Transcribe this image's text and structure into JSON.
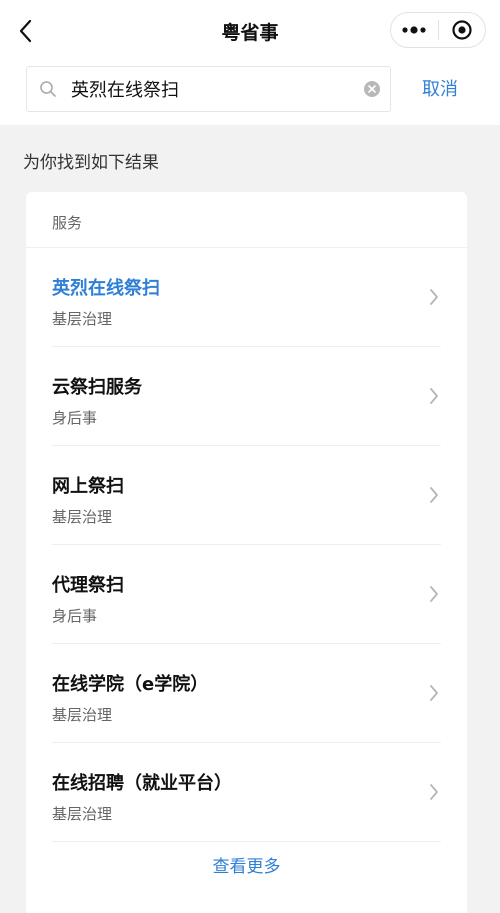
{
  "header": {
    "title": "粤省事",
    "back_icon": "chevron-left-icon",
    "more_icon": "more-dots-icon",
    "close_icon": "target-close-icon"
  },
  "search": {
    "value": "英烈在线祭扫",
    "placeholder": "",
    "cancel_label": "取消"
  },
  "results_heading": "为你找到如下结果",
  "service_section": {
    "label": "服务",
    "items": [
      {
        "title": "英烈在线祭扫",
        "subtitle": "基层治理",
        "highlighted": true
      },
      {
        "title": "云祭扫服务",
        "subtitle": "身后事",
        "highlighted": false
      },
      {
        "title": "网上祭扫",
        "subtitle": "基层治理",
        "highlighted": false
      },
      {
        "title": "代理祭扫",
        "subtitle": "身后事",
        "highlighted": false
      },
      {
        "title": "在线学院（e学院）",
        "subtitle": "基层治理",
        "highlighted": false
      },
      {
        "title": "在线招聘（就业平台）",
        "subtitle": "基层治理",
        "highlighted": false
      }
    ],
    "more_label": "查看更多"
  },
  "colors": {
    "accent": "#2f7fd6",
    "background": "#f2f2f2",
    "card": "#ffffff"
  }
}
